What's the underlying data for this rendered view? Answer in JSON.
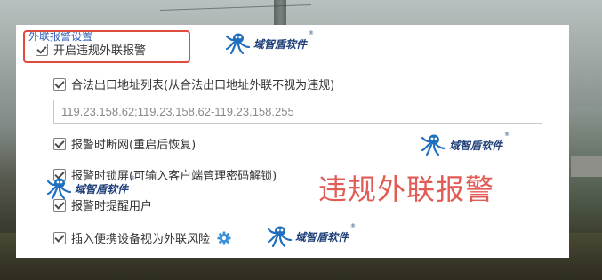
{
  "section_header": "外联报警设置",
  "main_option": {
    "label": "开启违规外联报警",
    "checked": true
  },
  "legal_addresses": {
    "label": "合法出口地址列表(从合法出口地址外联不视为违规)",
    "checked": true,
    "value": "119.23.158.62;119.23.158.62-119.23.158.255"
  },
  "disconnect_option": {
    "label": "报警时断网(重启后恢复)",
    "checked": true
  },
  "lock_option": {
    "label": "报警时锁屏(可输入客户端管理密码解锁)",
    "checked": true
  },
  "remind_option": {
    "label": "报警时提醒用户",
    "checked": true
  },
  "portable_option": {
    "label": "插入便携设备视为外联风险",
    "checked": true
  },
  "watermark": {
    "text": "域智盾软件",
    "mark": "®",
    "color": "#1e3f78"
  },
  "big_label": "违规外联报警",
  "colors": {
    "highlight": "#e04b3f",
    "big_label": "#e25b55",
    "gear": "#3b8fd6"
  }
}
